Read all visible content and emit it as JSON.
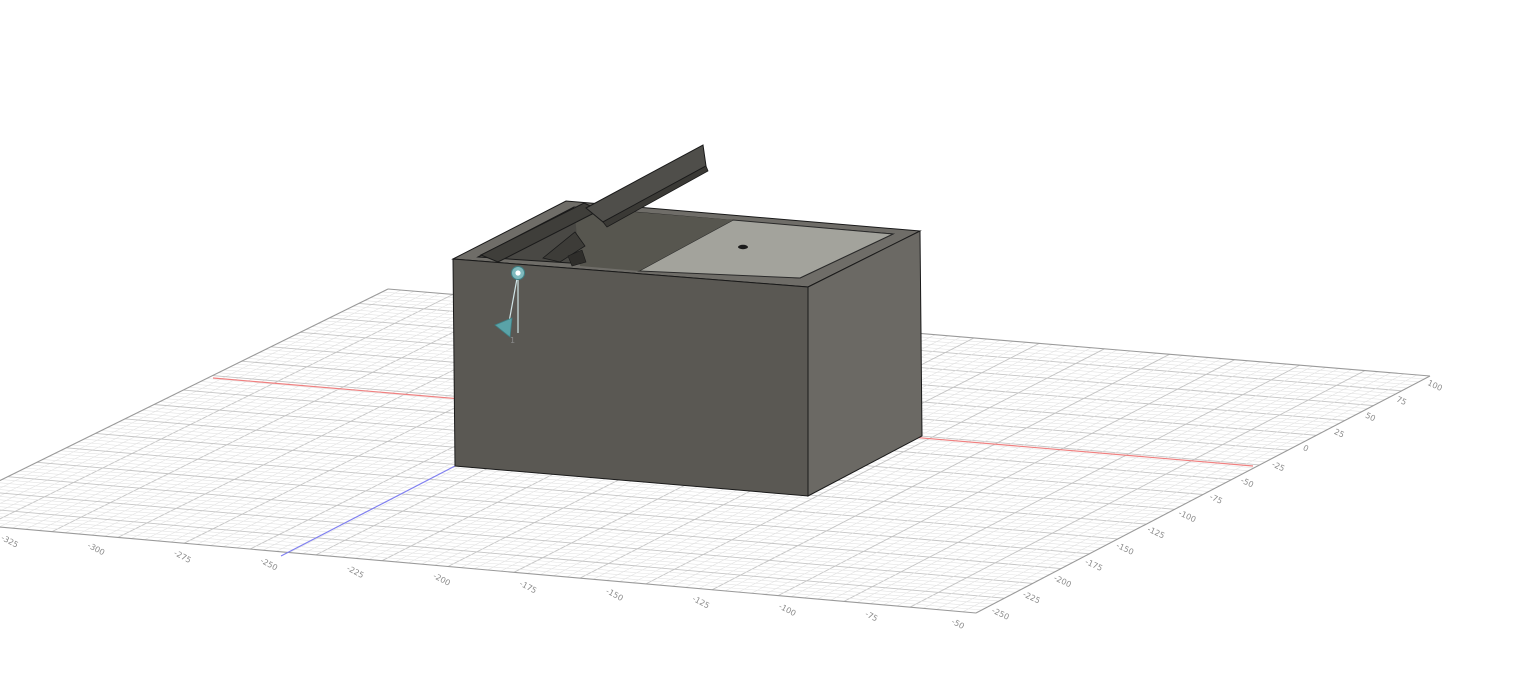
{
  "viewport": {
    "name": "3D modeling canvas",
    "background": "#ffffff"
  },
  "grid": {
    "minor_line_color": "#e3e3e3",
    "major_line_color": "#c4c4c4",
    "border_color": "#9a9a9a",
    "x_axis_color": "#f08080",
    "y_axis_color": "#8080f0",
    "right_edge_labels": [
      "-250",
      "-225",
      "-200",
      "-175",
      "-150",
      "-125",
      "-100",
      "-75",
      "-50",
      "-25",
      "0",
      "25",
      "50",
      "75",
      "100"
    ],
    "front_edge_labels": [
      "-325",
      "-300",
      "-275",
      "-250",
      "-225",
      "-200",
      "-175",
      "-150",
      "-125",
      "-100",
      "-75",
      "-50"
    ]
  },
  "model": {
    "type": "box with hinged lid",
    "colors": {
      "front_face": "#5a5853",
      "right_face": "#6b6964",
      "top_rim": "#6f6d68",
      "inner_floor": "#a3a39c",
      "cavity": "#494844",
      "lid": "#4f4e4a",
      "edges": "#1a1a1a"
    }
  },
  "gizmo": {
    "label": "Origin / joint marker",
    "color": "#5aa3a8"
  }
}
